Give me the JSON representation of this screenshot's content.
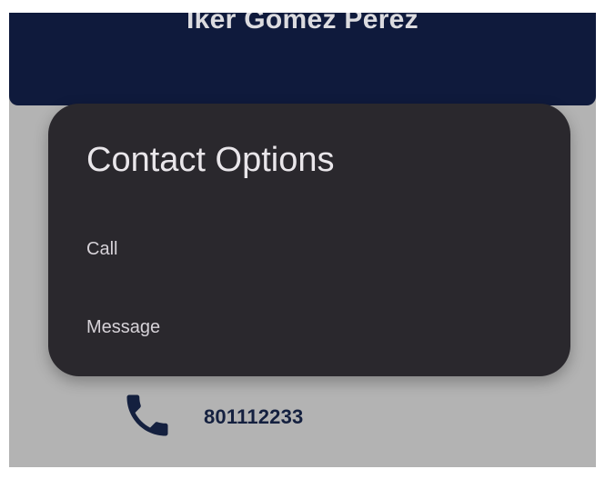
{
  "header": {
    "contact_name": "Iker Gomez Perez"
  },
  "contact": {
    "phone_icon": "phone-icon",
    "phone_number": "801112233"
  },
  "dialog": {
    "title": "Contact Options",
    "options": [
      {
        "label": "Call"
      },
      {
        "label": "Message"
      }
    ]
  },
  "colors": {
    "header_bg": "#0f1a3c",
    "page_bg": "#b3b3b3",
    "dialog_bg": "#2a282d",
    "accent_text": "#14203f"
  }
}
